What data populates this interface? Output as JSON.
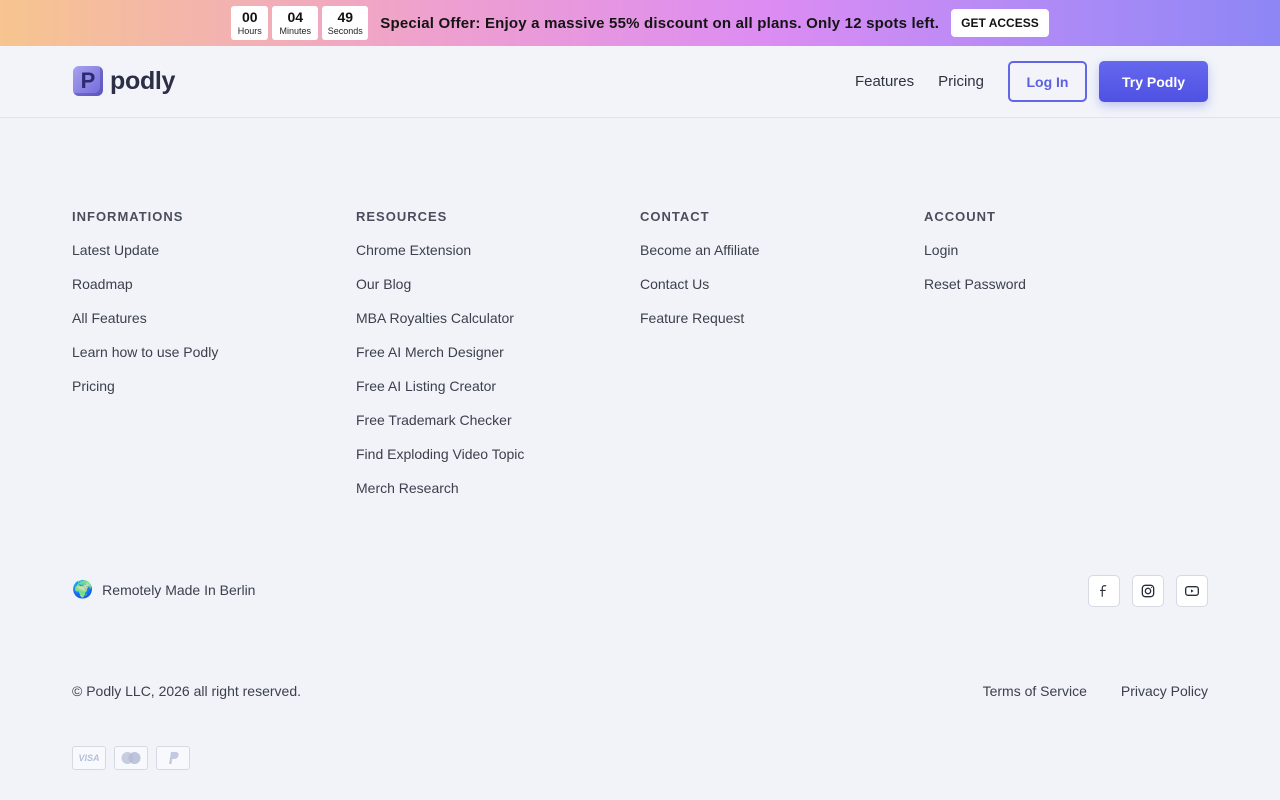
{
  "promo": {
    "timer": [
      {
        "value": "00",
        "label": "Hours"
      },
      {
        "value": "04",
        "label": "Minutes"
      },
      {
        "value": "49",
        "label": "Seconds"
      }
    ],
    "offer_strong": "Special Offer",
    "offer_text": ": Enjoy a massive 55% discount on all plans. Only 12 spots left.",
    "cta": "GET ACCESS"
  },
  "header": {
    "logo_letter": "P",
    "logo_text": "podly",
    "nav": [
      "Features",
      "Pricing"
    ],
    "login": "Log In",
    "try": "Try Podly"
  },
  "columns": [
    {
      "title": "INFORMATIONS",
      "links": [
        "Latest Update",
        "Roadmap",
        "All Features",
        "Learn how to use Podly",
        "Pricing"
      ]
    },
    {
      "title": "RESOURCES",
      "links": [
        "Chrome Extension",
        "Our Blog",
        "MBA Royalties Calculator",
        "Free AI Merch Designer",
        "Free AI Listing Creator",
        "Free Trademark Checker",
        "Find Exploding Video Topic",
        "Merch Research"
      ]
    },
    {
      "title": "CONTACT",
      "links": [
        "Become an Affiliate",
        "Contact Us",
        "Feature Request"
      ]
    },
    {
      "title": "ACCOUNT",
      "links": [
        "Login",
        "Reset Password"
      ]
    }
  ],
  "made_in": {
    "icon": "🌍",
    "text": "Remotely Made In Berlin"
  },
  "socials": [
    "facebook-icon",
    "instagram-icon",
    "youtube-icon"
  ],
  "copyright": "© Podly LLC, 2026 all right reserved.",
  "legal": [
    "Terms of Service",
    "Privacy Policy"
  ],
  "payments": {
    "visa": "VISA"
  },
  "colors": {
    "accent": "#5b5fe0",
    "background": "#f1f3f9"
  }
}
